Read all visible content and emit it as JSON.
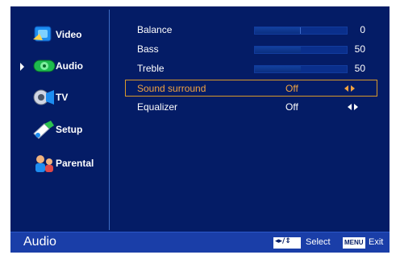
{
  "sidebar": {
    "items": [
      {
        "label": "Video",
        "icon": "video-icon",
        "selected": false
      },
      {
        "label": "Audio",
        "icon": "audio-icon",
        "selected": true
      },
      {
        "label": "TV",
        "icon": "tv-icon",
        "selected": false
      },
      {
        "label": "Setup",
        "icon": "setup-icon",
        "selected": false
      },
      {
        "label": "Parental",
        "icon": "parental-icon",
        "selected": false
      }
    ]
  },
  "settings": {
    "rows": [
      {
        "label": "Balance",
        "value": "0",
        "level": 0.5
      },
      {
        "label": "Bass",
        "value": "50",
        "level": 0.5
      },
      {
        "label": "Treble",
        "value": "50",
        "level": 0.5
      },
      {
        "label": "Sound surround",
        "value": "Off",
        "selected": true
      },
      {
        "label": "Equalizer",
        "value": "Off",
        "selected": false
      }
    ]
  },
  "footer": {
    "title": "Audio",
    "select_label": "Select",
    "menu_key": "MENU",
    "exit_label": "Exit"
  },
  "colors": {
    "background": "#041c66",
    "footer": "#1a3ea8",
    "highlight": "#f2a341",
    "divider": "#3e6ec6"
  }
}
